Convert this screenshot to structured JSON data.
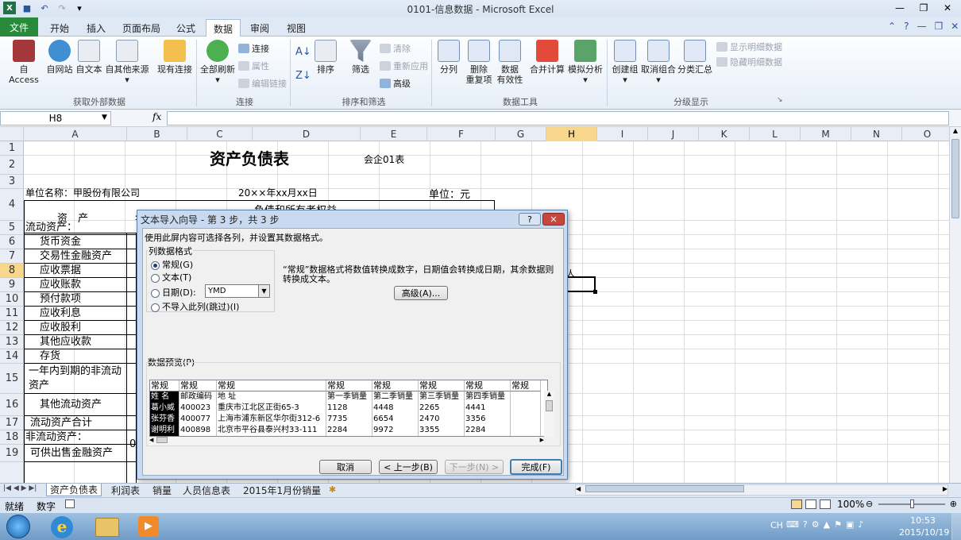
{
  "window": {
    "title": "0101-信息数据 - Microsoft Excel"
  },
  "tabs": [
    "开始",
    "插入",
    "页面布局",
    "公式",
    "数据",
    "审阅",
    "视图"
  ],
  "file_tab": "文件",
  "active_tab": "数据",
  "ribbon": {
    "get_external": {
      "items": [
        "自 Access",
        "自网站",
        "自文本",
        "自其他来源",
        "现有连接"
      ],
      "label": "获取外部数据"
    },
    "connections": {
      "refresh": "全部刷新",
      "small": [
        "连接",
        "属性",
        "编辑链接"
      ],
      "label": "连接"
    },
    "sort_filter": {
      "sort": "排序",
      "filter": "筛选",
      "small": [
        "清除",
        "重新应用",
        "高级"
      ],
      "label": "排序和筛选"
    },
    "data_tools": {
      "items": [
        "分列",
        "删除\n重复项",
        "数据\n有效性",
        "合并计算",
        "模拟分析"
      ],
      "label": "数据工具"
    },
    "outline": {
      "items": [
        "创建组",
        "取消组合",
        "分类汇总"
      ],
      "small": [
        "显示明细数据",
        "隐藏明细数据"
      ],
      "label": "分级显示"
    }
  },
  "formula": {
    "namebox": "H8",
    "fx": "fx"
  },
  "columns": [
    "A",
    "B",
    "C",
    "D",
    "E",
    "F",
    "G",
    "H",
    "I",
    "J",
    "K",
    "L",
    "M",
    "N",
    "O"
  ],
  "rows": [
    "1",
    "2",
    "3",
    "4",
    "5",
    "6",
    "7",
    "8",
    "9",
    "10",
    "11",
    "12",
    "13",
    "14",
    "15",
    "16",
    "17",
    "18",
    "19"
  ],
  "sheet": {
    "title": "资产负债表",
    "form_no": "会企01表",
    "company": "单位名称：甲股份有限公司",
    "date": "20××年xx月xx日",
    "unit": "单位：元",
    "asset_header": "资　产",
    "liab_header": "负债和所有者权益",
    "col_b4": "年",
    "col_b17": "0",
    "items": [
      "流动资产：",
      "货币资金",
      "交易性金融资产",
      "应收票据",
      "应收账款",
      "预付款项",
      "应收利息",
      "应收股利",
      "其他应收款",
      "存货",
      "一年内到期的非流动资产",
      "其他流动资产",
      "流动资产合计",
      "非流动资产：",
      "可供出售金融资产"
    ],
    "right_fragment": "人"
  },
  "dialog": {
    "title": "文本导入向导 - 第 3 步，共 3 步",
    "help": "?",
    "close": "✕",
    "instruction": "使用此屏内容可选择各列，并设置其数据格式。",
    "group_label": "列数据格式",
    "options": [
      "常规(G)",
      "文本(T)",
      "日期(D):",
      "不导入此列(跳过)(I)"
    ],
    "selected_option": "常规(G)",
    "date_value": "YMD",
    "description": "“常规”数据格式将数值转换成数字，日期值会转换成日期，其余数据则转换成文本。",
    "advanced": "高级(A)...",
    "preview_label": "数据预览(P)",
    "preview": {
      "headers": [
        "常规",
        "常规",
        "常规",
        "常规",
        "常规",
        "常规",
        "常规",
        "常规"
      ],
      "rows": [
        [
          "姓 名",
          "邮政编码",
          "地 址",
          "第一季销量",
          "第二季销量",
          "第三季销量",
          "第四季销量",
          ""
        ],
        [
          "葛小威",
          "400023",
          "重庆市江北区正街65-3",
          "1128",
          "4448",
          "2265",
          "4441",
          ""
        ],
        [
          "张芬香",
          "400077",
          "上海市浦东新区华尔街312-6",
          "7735",
          "6654",
          "2470",
          "3356",
          ""
        ],
        [
          "谢明利",
          "400898",
          "北京市平谷县泰兴村33-111",
          "2284",
          "9972",
          "3355",
          "2284",
          ""
        ]
      ]
    },
    "buttons": {
      "cancel": "取消",
      "back": "< 上一步(B)",
      "next": "下一步(N) >",
      "finish": "完成(F)"
    }
  },
  "sheet_tabs": [
    "资产负债表",
    "利润表",
    "销量",
    "人员信息表",
    "2015年1月份销量"
  ],
  "active_sheet": "资产负债表",
  "status": {
    "ready": "就绪",
    "num": "数字",
    "zoom": "100%"
  },
  "taskbar": {
    "lang": "CH",
    "time": "10:53",
    "date": "2015/10/19"
  }
}
